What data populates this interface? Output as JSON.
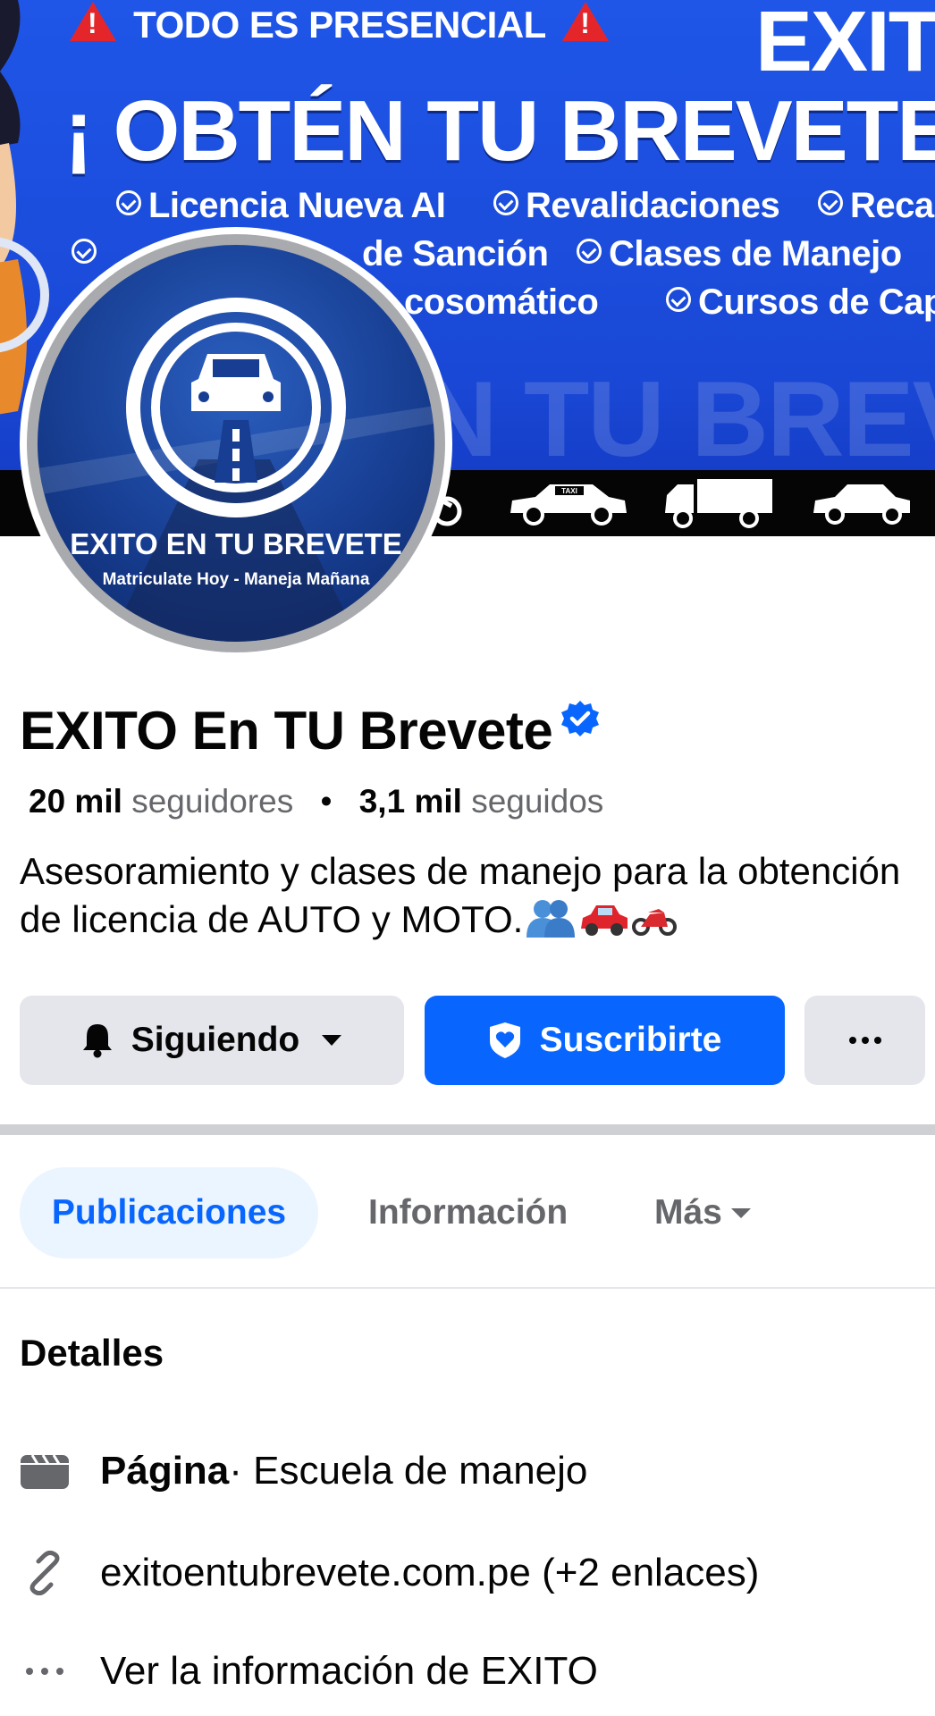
{
  "cover": {
    "line1": "TODO ES PRESENCIAL",
    "brand": "EXITO",
    "headline": "¡ OBTÉN TU BREVETE YA",
    "services_row1": [
      "Licencia Nueva AI",
      "Revalidaciones",
      "Reca"
    ],
    "services_row2": [
      "de Sanción",
      "Clases de Manejo"
    ],
    "services_row3": [
      "cosomático",
      "Cursos de Cap"
    ],
    "watermark": "N TU BREVE",
    "taxi_label": "TAXI"
  },
  "avatar": {
    "brand": "EXITO EN TU BREVETE",
    "slogan": "Matriculate Hoy - Maneja Mañana"
  },
  "profile": {
    "name": "EXITO En TU Brevete",
    "followers_count": "20 mil",
    "followers_label": "seguidores",
    "separator": "•",
    "following_count": "3,1 mil",
    "following_label": "seguidos",
    "bio": "Asesoramiento y clases de manejo para la obtención de licencia de AUTO y MOTO."
  },
  "actions": {
    "follow_label": "Siguiendo",
    "subscribe_label": "Suscribirte",
    "more_label": "···"
  },
  "tabs": [
    {
      "label": "Publicaciones",
      "active": true
    },
    {
      "label": "Información",
      "active": false
    },
    {
      "label": "Más",
      "active": false
    }
  ],
  "details": {
    "title": "Detalles",
    "category_strong": "Página",
    "category_rest": " · Escuela de manejo",
    "link_text": "exitoentubrevete.com.pe (+2 enlaces)",
    "more_info": "Ver la información de EXITO"
  },
  "colors": {
    "accent": "#0866ff",
    "cover_blue": "#1f56e8",
    "button_gray": "#e4e6eb",
    "tab_active_bg": "#ebf5ff"
  }
}
